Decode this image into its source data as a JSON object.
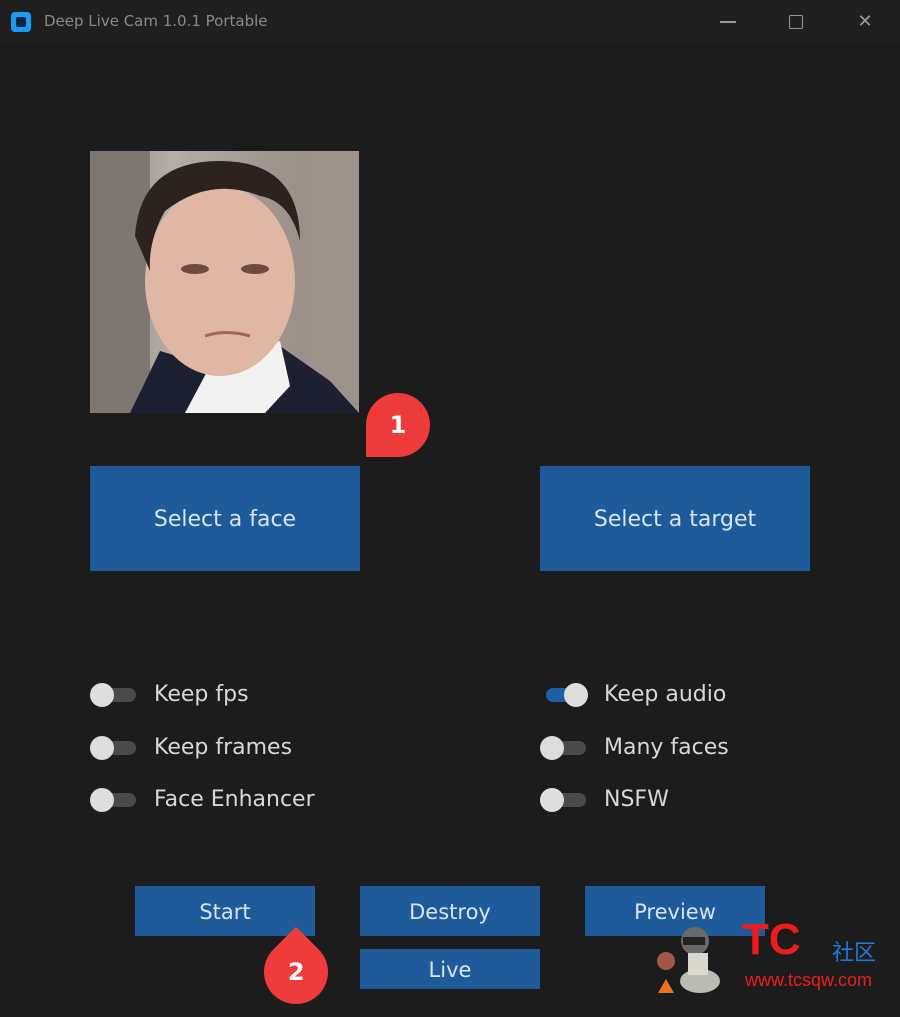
{
  "window": {
    "title": "Deep Live Cam 1.0.1 Portable",
    "controls": {
      "minimize": "minimize",
      "maximize": "maximize",
      "close": "close"
    }
  },
  "source_image": {
    "alt": "Selected source face photo"
  },
  "buttons": {
    "select_face": "Select a face",
    "select_target": "Select a target",
    "start": "Start",
    "destroy": "Destroy",
    "preview": "Preview",
    "live": "Live"
  },
  "switches": [
    {
      "label": "Keep fps",
      "on": false
    },
    {
      "label": "Keep frames",
      "on": false
    },
    {
      "label": "Face Enhancer",
      "on": false
    },
    {
      "label": "Keep audio",
      "on": true
    },
    {
      "label": "Many faces",
      "on": false
    },
    {
      "label": "NSFW",
      "on": false
    }
  ],
  "annotations": [
    {
      "number": "1",
      "target": "Select a face"
    },
    {
      "number": "2",
      "target": "Live"
    }
  ],
  "watermark": {
    "brand": "TC",
    "brand_cn": "社区",
    "url": "www.tcsqw.com"
  },
  "colors": {
    "accent": "#1f5a9b",
    "background": "#1c1c1c",
    "marker": "#ee3b3b",
    "switch_on": "#1f5ea8"
  }
}
